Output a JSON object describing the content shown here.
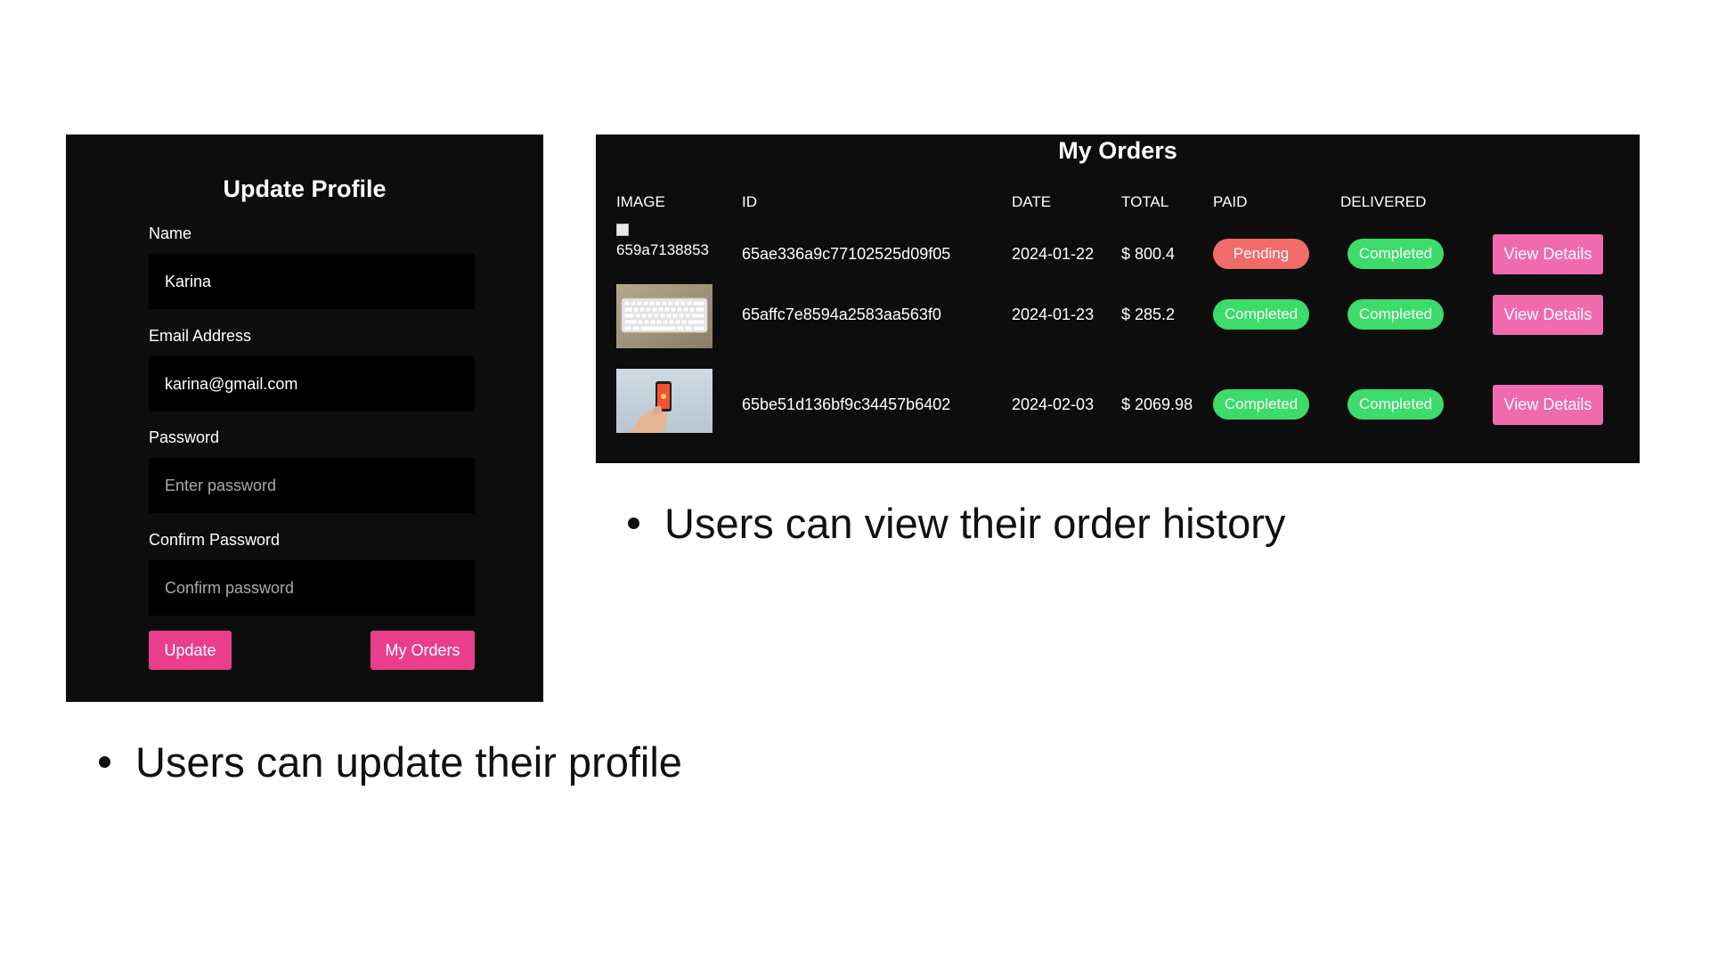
{
  "profile": {
    "title": "Update Profile",
    "name_label": "Name",
    "name_value": "Karina",
    "email_label": "Email Address",
    "email_value": "karina@gmail.com",
    "password_label": "Password",
    "password_placeholder": "Enter password",
    "confirm_label": "Confirm Password",
    "confirm_placeholder": "Confirm password",
    "update_button": "Update",
    "my_orders_button": "My Orders"
  },
  "orders": {
    "title": "My Orders",
    "columns": {
      "image": "IMAGE",
      "id": "ID",
      "date": "DATE",
      "total": "TOTAL",
      "paid": "PAID",
      "delivered": "DELIVERED"
    },
    "rows": [
      {
        "image_alt": "659a7138853",
        "image_icon": "broken-image-icon",
        "id": "65ae336a9c77102525d09f05",
        "date": "2024-01-22",
        "total": "$ 800.4",
        "paid": "Pending",
        "delivered": "Completed",
        "action": "View Details"
      },
      {
        "image_icon": "keyboard-photo",
        "id": "65affc7e8594a2583aa563f0",
        "date": "2024-01-23",
        "total": "$ 285.2",
        "paid": "Completed",
        "delivered": "Completed",
        "action": "View Details"
      },
      {
        "image_icon": "phone-in-hand-photo",
        "id": "65be51d136bf9c34457b6402",
        "date": "2024-02-03",
        "total": "$ 2069.98",
        "paid": "Completed",
        "delivered": "Completed",
        "action": "View Details"
      }
    ]
  },
  "captions": {
    "orders": "Users can view their order history",
    "profile": "Users can update their profile"
  },
  "colors": {
    "card_bg": "#0d0d0d",
    "input_bg": "#000000",
    "primary_pink": "#e83e8c",
    "details_pink": "#f06aaf",
    "pending_red": "#f26b6b",
    "completed_green": "#3ddc6a"
  }
}
